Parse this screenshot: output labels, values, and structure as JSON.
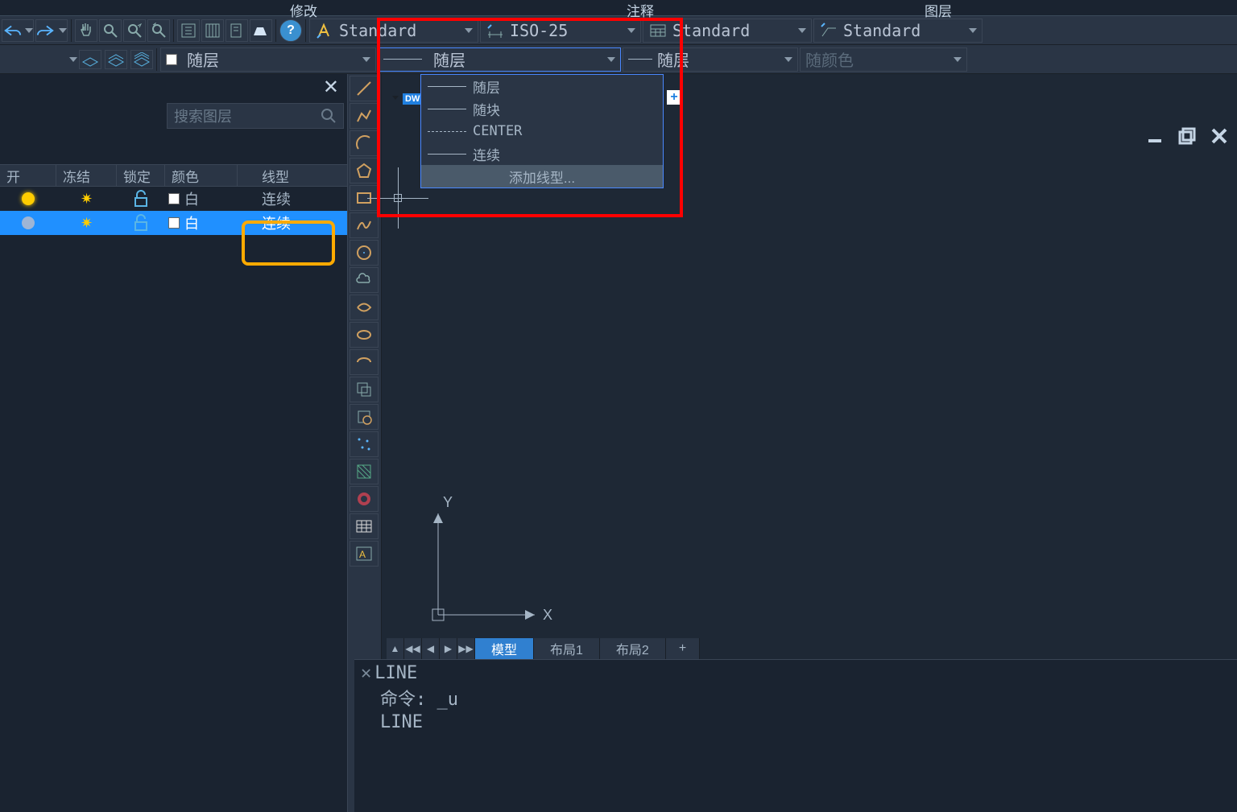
{
  "tabs": {
    "modify": "修改",
    "annotation": "注释",
    "layers": "图层"
  },
  "styles": {
    "text_style": "Standard",
    "dim_style": "ISO-25",
    "table_style": "Standard",
    "mleader_style": "Standard"
  },
  "properties_row": {
    "layer_color": "随层",
    "linetype": "随层",
    "lineweight": "随层",
    "bycolor": "随颜色"
  },
  "linetype_dropdown": {
    "items": [
      {
        "label": "随层",
        "style": "solid"
      },
      {
        "label": "随块",
        "style": "solid"
      },
      {
        "label": "CENTER",
        "style": "dash"
      },
      {
        "label": "连续",
        "style": "solid"
      },
      {
        "label": "添加线型...",
        "style": "none",
        "highlighted": true
      }
    ]
  },
  "layer_panel": {
    "search_placeholder": "搜索图层",
    "columns": {
      "on": "开",
      "freeze": "冻结",
      "lock": "锁定",
      "color": "颜色",
      "linetype": "线型"
    },
    "rows": [
      {
        "on": true,
        "color_label": "白",
        "linetype": "连续",
        "selected": false
      },
      {
        "on": false,
        "color_label": "白",
        "linetype": "连续",
        "selected": true
      }
    ]
  },
  "doc_tab": {
    "badge": "DW"
  },
  "ucs": {
    "x": "X",
    "y": "Y"
  },
  "layout_tabs": {
    "model": "模型",
    "layout1": "布局1",
    "layout2": "布局2"
  },
  "command": {
    "line1": "LINE",
    "line2_prefix": "命令:",
    "line2_cmd": "_u",
    "line3": "LINE"
  }
}
